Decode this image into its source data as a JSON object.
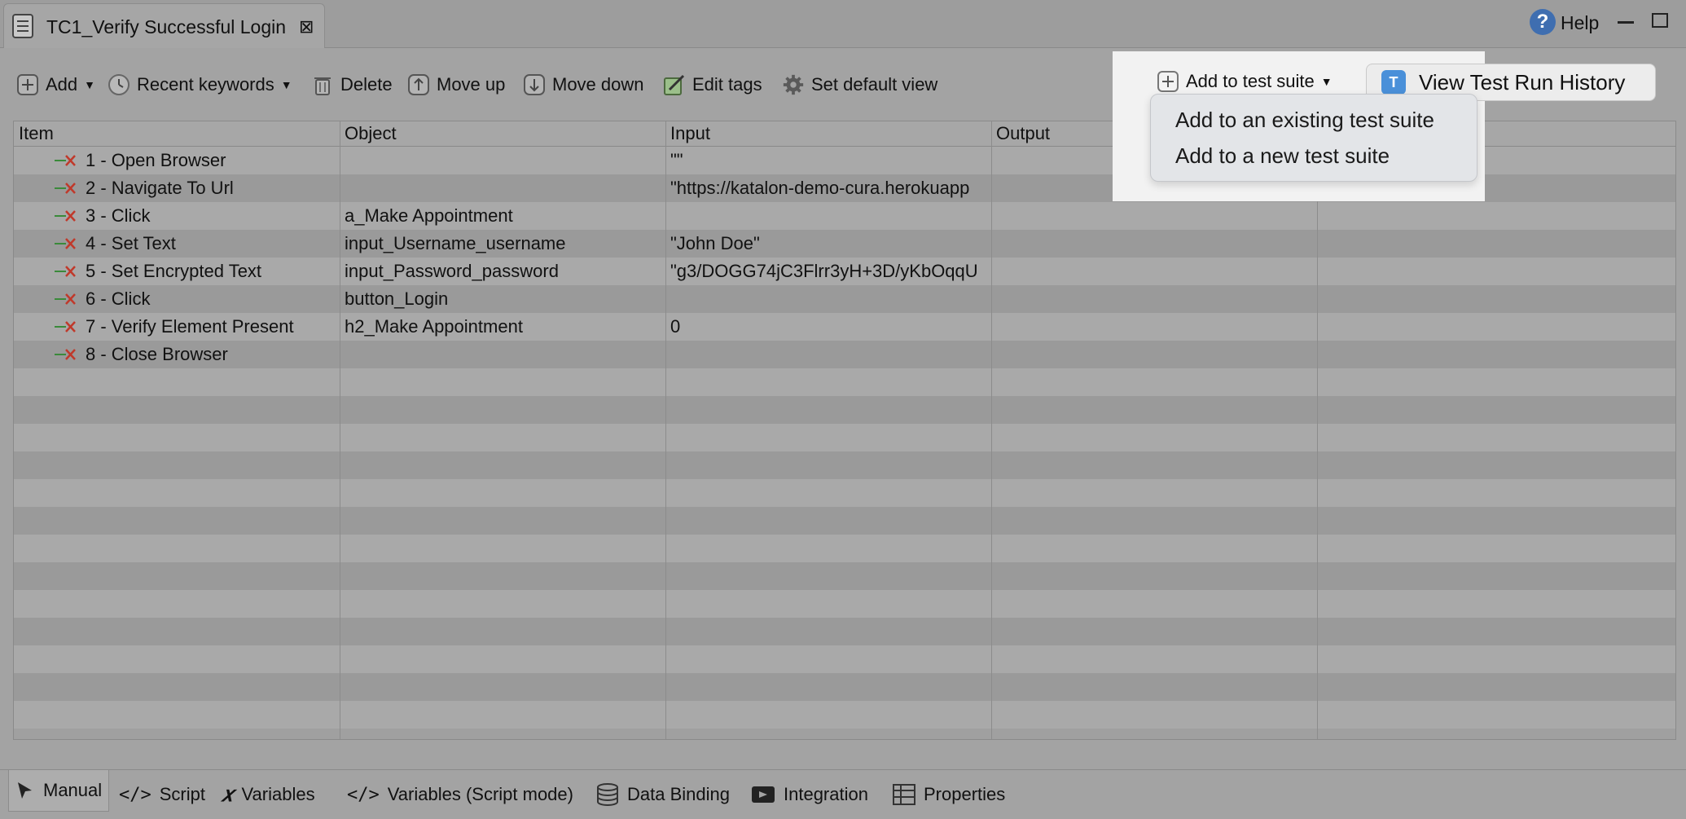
{
  "tab": {
    "title": "TC1_Verify Successful Login",
    "close_glyph": "⊠"
  },
  "window": {
    "help_label": "Help",
    "help_glyph": "?"
  },
  "toolbar": {
    "add": "Add",
    "recent": "Recent keywords",
    "delete": "Delete",
    "move_up": "Move up",
    "move_down": "Move down",
    "edit_tags": "Edit tags",
    "set_default_view": "Set default view",
    "add_to_suite": "Add to test suite",
    "view_history": "View Test Run History"
  },
  "dropdown": {
    "items": [
      "Add to an existing test suite",
      "Add to a new test suite"
    ]
  },
  "table": {
    "headers": [
      "Item",
      "Object",
      "Input",
      "Output"
    ],
    "rows": [
      {
        "item": "1 - Open Browser",
        "object": "",
        "input": "\"\""
      },
      {
        "item": "2 - Navigate To Url",
        "object": "",
        "input": "\"https://katalon-demo-cura.herokuapp"
      },
      {
        "item": "3 - Click",
        "object": "a_Make Appointment",
        "input": ""
      },
      {
        "item": "4 - Set Text",
        "object": "input_Username_username",
        "input": "\"John Doe\""
      },
      {
        "item": "5 - Set Encrypted Text",
        "object": "input_Password_password",
        "input": "\"g3/DOGG74jC3Flrr3yH+3D/yKbOqqU"
      },
      {
        "item": "6 - Click",
        "object": "button_Login",
        "input": ""
      },
      {
        "item": "7 - Verify Element Present",
        "object": "h2_Make Appointment",
        "input": "0"
      },
      {
        "item": "8 - Close Browser",
        "object": "",
        "input": ""
      }
    ]
  },
  "bottom_tabs": [
    "Manual",
    "Script",
    "Variables",
    "Variables (Script mode)",
    "Data Binding",
    "Integration",
    "Properties"
  ],
  "colors": {
    "accent": "#3f6eb0",
    "step_arrow": "#3a8a3a",
    "step_x": "#c0392b"
  }
}
